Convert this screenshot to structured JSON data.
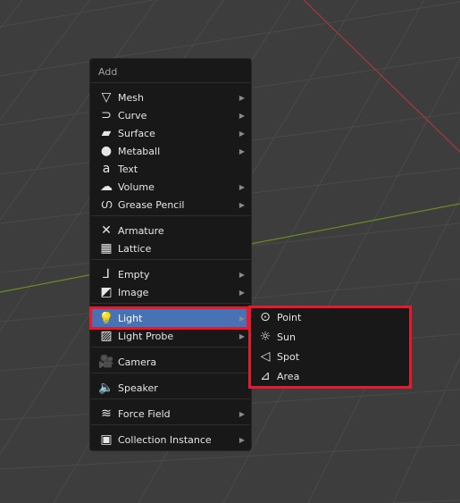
{
  "menu": {
    "title": "Add",
    "groups": [
      [
        {
          "label": "Mesh",
          "icon": "mesh-icon",
          "g": "▽",
          "sub": true
        },
        {
          "label": "Curve",
          "icon": "curve-icon",
          "g": "⊃",
          "sub": true
        },
        {
          "label": "Surface",
          "icon": "surface-icon",
          "g": "▰",
          "sub": true
        },
        {
          "label": "Metaball",
          "icon": "metaball-icon",
          "g": "●",
          "sub": true
        },
        {
          "label": "Text",
          "icon": "text-icon",
          "g": "a",
          "sub": false
        },
        {
          "label": "Volume",
          "icon": "volume-icon",
          "g": "☁",
          "sub": true
        },
        {
          "label": "Grease Pencil",
          "icon": "grease-pencil-icon",
          "g": "ഗ",
          "sub": true
        }
      ],
      [
        {
          "label": "Armature",
          "icon": "armature-icon",
          "g": "✕",
          "sub": false
        },
        {
          "label": "Lattice",
          "icon": "lattice-icon",
          "g": "▦",
          "sub": false
        }
      ],
      [
        {
          "label": "Empty",
          "icon": "empty-icon",
          "g": "⅃",
          "sub": true
        },
        {
          "label": "Image",
          "icon": "image-icon",
          "g": "◩",
          "sub": true
        }
      ],
      [
        {
          "label": "Light",
          "icon": "light-bulb-icon",
          "g": "💡",
          "sub": true,
          "active": true
        },
        {
          "label": "Light Probe",
          "icon": "light-probe-icon",
          "g": "▨",
          "sub": true
        }
      ],
      [
        {
          "label": "Camera",
          "icon": "camera-icon",
          "g": "🎥",
          "sub": false
        }
      ],
      [
        {
          "label": "Speaker",
          "icon": "speaker-icon",
          "g": "🔈",
          "sub": false
        }
      ],
      [
        {
          "label": "Force Field",
          "icon": "force-field-icon",
          "g": "≋",
          "sub": true
        }
      ],
      [
        {
          "label": "Collection Instance",
          "icon": "collection-instance-icon",
          "g": "▣",
          "sub": true
        }
      ]
    ]
  },
  "submenu": {
    "items": [
      {
        "label": "Point",
        "icon": "point-light-icon",
        "g": "⊙"
      },
      {
        "label": "Sun",
        "icon": "sun-light-icon",
        "g": "☼"
      },
      {
        "label": "Spot",
        "icon": "spot-light-icon",
        "g": "◁"
      },
      {
        "label": "Area",
        "icon": "area-light-icon",
        "g": "⊿"
      }
    ]
  },
  "colors": {
    "highlight": "#4772b3",
    "annotation": "#e8192c",
    "x_axis": "#a83a3a",
    "y_axis": "#6b8c22"
  }
}
